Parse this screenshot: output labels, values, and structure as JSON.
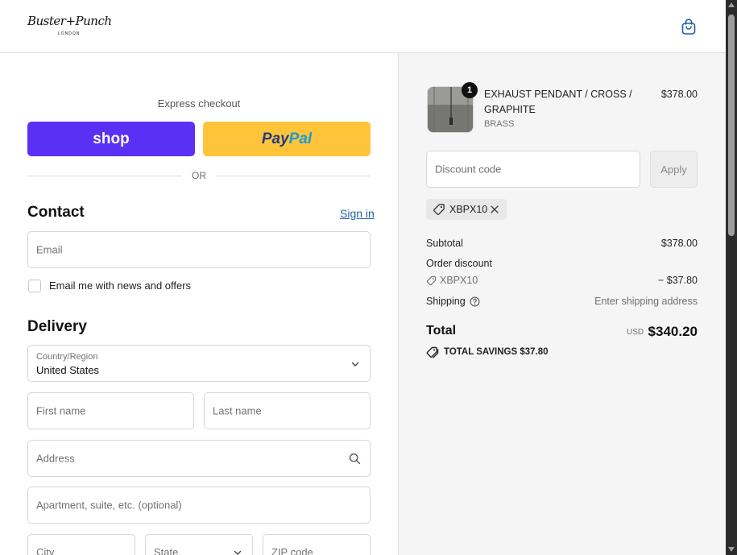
{
  "header": {
    "logo_text": "Buster+Punch",
    "logo_sub": "LONDON"
  },
  "express": {
    "label": "Express checkout",
    "shop_label": "shop",
    "paypal_part1": "Pay",
    "paypal_part2": "Pal",
    "or_text": "OR"
  },
  "contact": {
    "title": "Contact",
    "signin": "Sign in",
    "email_placeholder": "Email",
    "newsletter_label": "Email me with news and offers"
  },
  "delivery": {
    "title": "Delivery",
    "country_label": "Country/Region",
    "country_value": "United States",
    "first_name": "First name",
    "last_name": "Last name",
    "address": "Address",
    "apartment": "Apartment, suite, etc. (optional)",
    "city": "City",
    "state": "State",
    "zip": "ZIP code"
  },
  "cart": {
    "quantity": "1",
    "product_name": "EXHAUST PENDANT / CROSS / GRAPHITE",
    "product_variant": "BRASS",
    "product_price": "$378.00",
    "discount_placeholder": "Discount code",
    "apply_label": "Apply",
    "applied_code": "XBPX10"
  },
  "summary": {
    "subtotal_label": "Subtotal",
    "subtotal_value": "$378.00",
    "order_discount_label": "Order discount",
    "discount_code": "XBPX10",
    "discount_value": "− $37.80",
    "shipping_label": "Shipping",
    "shipping_value": "Enter shipping address",
    "total_label": "Total",
    "total_currency": "USD",
    "total_value": "$340.20",
    "savings_label": "TOTAL SAVINGS",
    "savings_value": "$37.80"
  },
  "colors": {
    "shop_purple": "#5a31f4",
    "paypal_yellow": "#ffc439",
    "link_blue": "#1f5ea8",
    "summary_bg": "#f5f5f5"
  }
}
